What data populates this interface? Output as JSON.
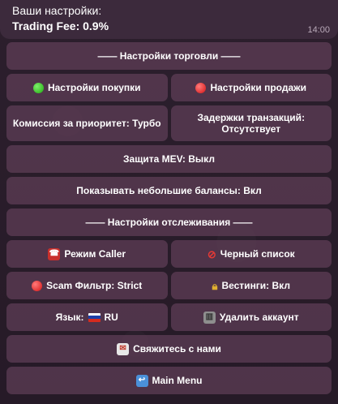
{
  "message": {
    "line1": "Ваши настройки:",
    "line2": "Trading Fee: 0.9%",
    "time": "14:00"
  },
  "keyboard": {
    "trade_settings_header": "—— Настройки торговли ——",
    "buy_settings": "Настройки покупки",
    "sell_settings": "Настройки продажи",
    "priority_fee": "Комиссия за приоритет: Турбо",
    "tx_delays": "Задержки транзакций: Отсутствует",
    "mev_protection": "Защита MEV: Выкл",
    "show_small_balances": "Показывать небольшие балансы: Вкл",
    "tracking_settings_header": "—— Настройки отслеживания ——",
    "caller_mode": "Режим Caller",
    "blacklist": "Черный список",
    "scam_filter": "Scam Фильтр: Strict",
    "vestings": "Вестинги: Вкл",
    "language": "Язык:",
    "language_value": "RU",
    "delete_account": "Удалить аккаунт",
    "contact_us": "Свяжитесь с нами",
    "main_menu": "Main Menu"
  },
  "icons": {
    "buy": "green-circle-icon",
    "sell": "red-circle-icon",
    "caller": "telephone-icon",
    "blacklist": "prohibited-icon",
    "scam": "no-entry-icon",
    "vestings": "lock-icon",
    "language": "russia-flag-icon",
    "delete": "trash-icon",
    "contact": "envelope-icon",
    "main_menu": "return-arrow-icon"
  },
  "colors": {
    "background": "#2a1d2b",
    "bubble": "#3c2a3c",
    "button": "#5f3e58"
  }
}
